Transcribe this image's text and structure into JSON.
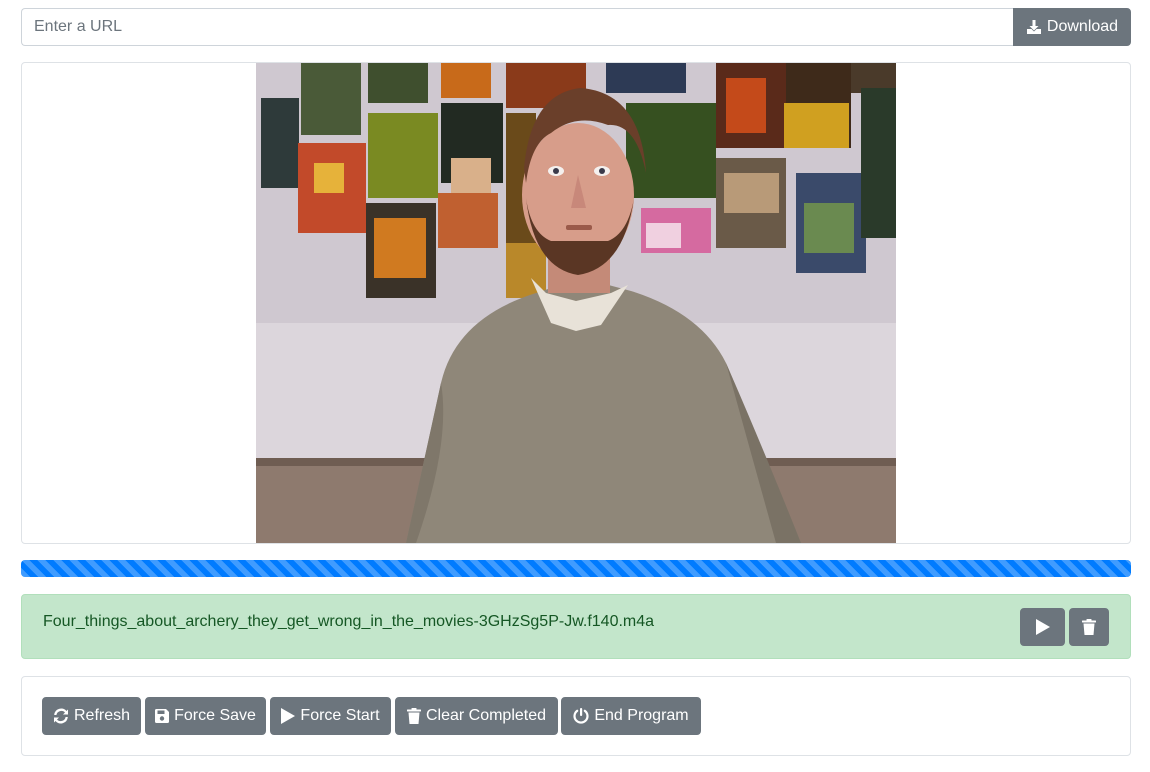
{
  "url_bar": {
    "placeholder": "Enter a URL",
    "value": "",
    "download_label": "Download",
    "download_icon": "download-icon"
  },
  "video": {
    "description_icon": "video-frame"
  },
  "progress": {
    "fraction": 1.0,
    "color": "#007bff",
    "striped": true
  },
  "file": {
    "name": "Four_things_about_archery_they_get_wrong_in_the_movies-3GHzSg5P-Jw.f140.m4a",
    "background": "#c3e6cb",
    "play_icon": "play-icon",
    "delete_icon": "trash-icon"
  },
  "controls": {
    "refresh_label": "Refresh",
    "force_save_label": "Force Save",
    "force_start_label": "Force Start",
    "clear_completed_label": "Clear Completed",
    "end_program_label": "End Program"
  },
  "colors": {
    "button": "#6c757d",
    "accent": "#007bff",
    "success_bg": "#c3e6cb",
    "success_text": "#155724"
  }
}
